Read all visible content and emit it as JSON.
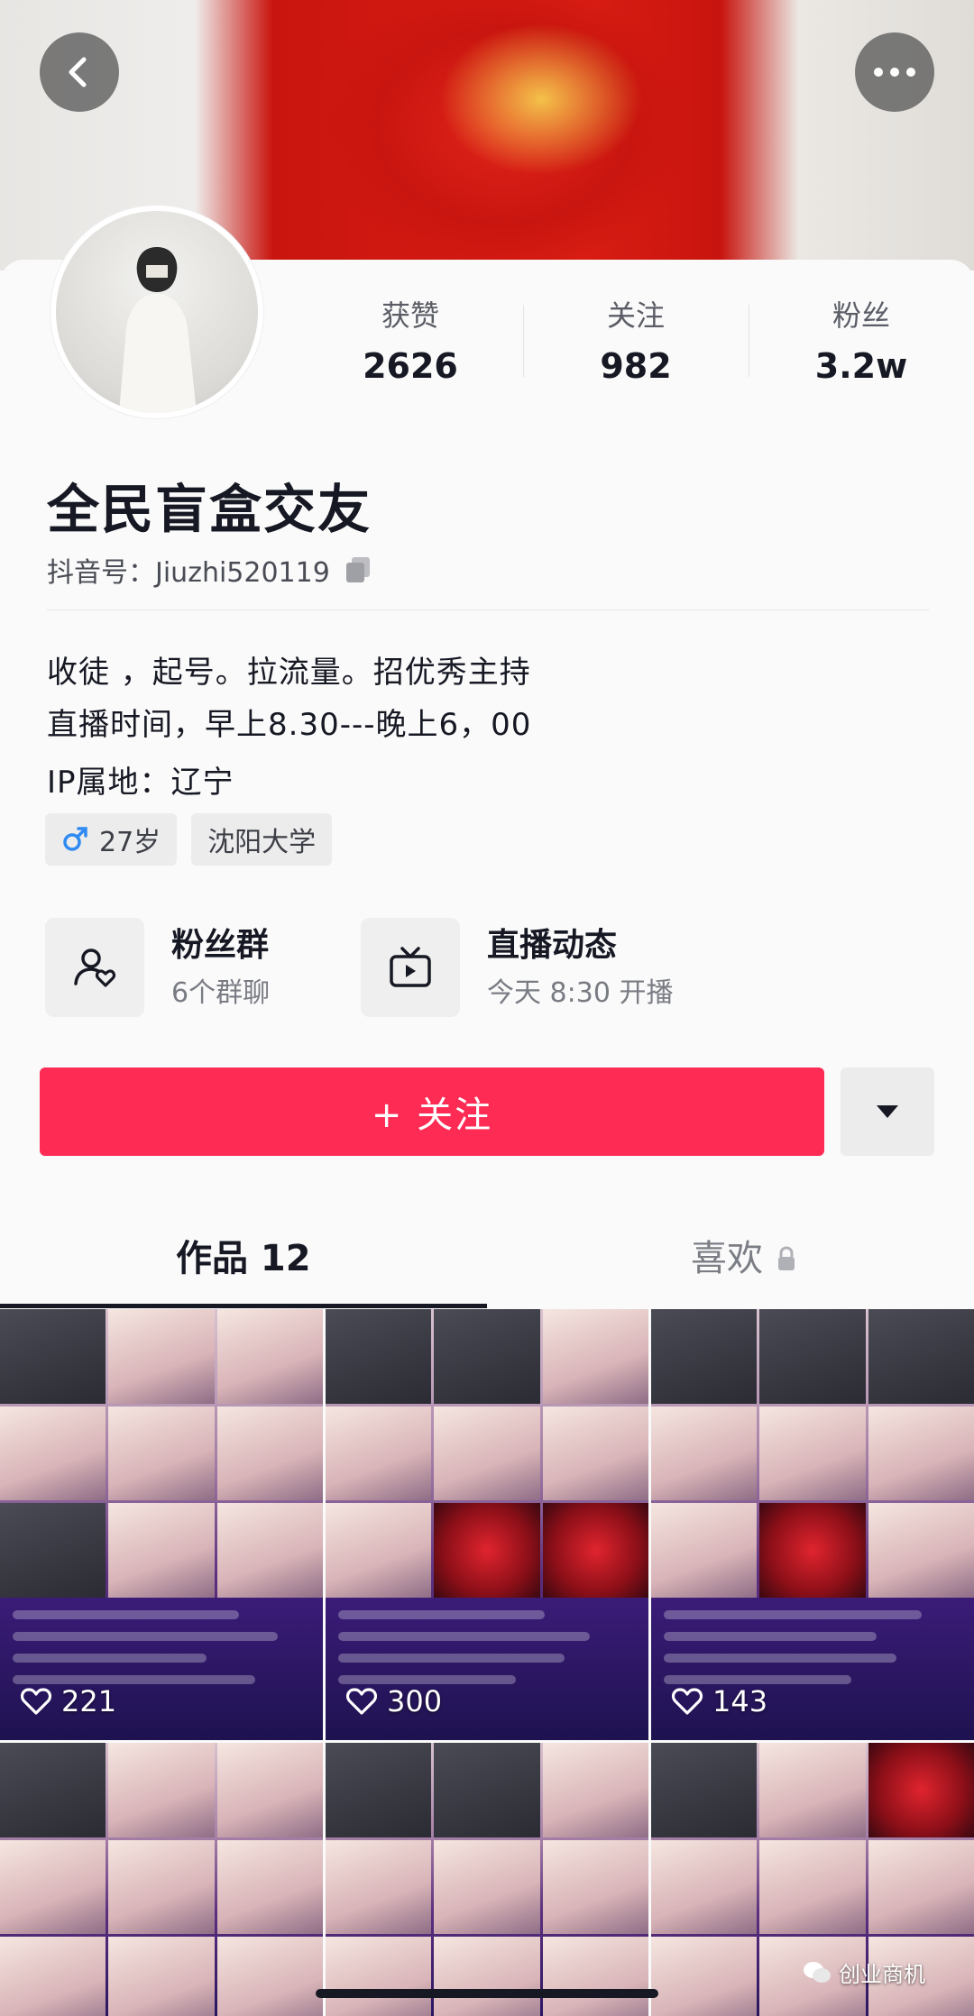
{
  "header": {
    "back_icon": "chevron-left-icon",
    "more_icon": "more-dots-icon"
  },
  "stats": [
    {
      "label": "获赞",
      "value": "2626"
    },
    {
      "label": "关注",
      "value": "982"
    },
    {
      "label": "粉丝",
      "value": "3.2w"
    }
  ],
  "profile": {
    "name": "全民盲盒交友",
    "uid": "抖音号：Jiuzhi520119",
    "bio_line1": "收徒 ，起号。拉流量。招优秀主持",
    "bio_line2": "直播时间，早上8.30---晚上6，00",
    "ip": "IP属地：辽宁",
    "age": "27岁",
    "school": "沈阳大学"
  },
  "features": {
    "fans_group": {
      "title": "粉丝群",
      "sub": "6个群聊",
      "icon": "group-heart-icon"
    },
    "live": {
      "title": "直播动态",
      "sub": "今天 8:30 开播",
      "icon": "tv-icon"
    }
  },
  "actions": {
    "follow_label": "+ 关注",
    "more_icon": "triangle-down-icon"
  },
  "tabs": {
    "works": "作品 12",
    "likes": "喜欢"
  },
  "grid": {
    "items": [
      {
        "likes": "221"
      },
      {
        "likes": "300"
      },
      {
        "likes": "143"
      },
      {
        "likes": ""
      },
      {
        "likes": ""
      },
      {
        "likes": ""
      }
    ]
  },
  "watermark": "创业商机",
  "colors": {
    "accent": "#fe2c55",
    "male": "#2f8bf1",
    "text": "#161823"
  }
}
